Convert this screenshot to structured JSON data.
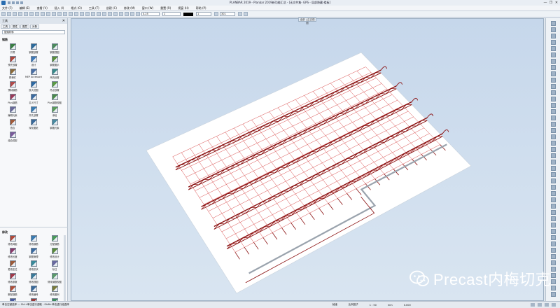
{
  "titlebar": {
    "title": "PLANBAR 2019 - Planbar 2019新功能汇总 - [无文件集- GPS - 局部隐藏-楼板]",
    "controls": [
      "—",
      "❐",
      "✕"
    ]
  },
  "menu": [
    "文件 (F)",
    "编辑 (E)",
    "查看 (V)",
    "插入 (I)",
    "格式 (O)",
    "工具 (T)",
    "创建 (C)",
    "修改 (M)",
    "窗口 (W)",
    "重置 (R)",
    "视窗 (H)",
    "帮助 (P)"
  ],
  "toolbar": {
    "pen_size": "0.25",
    "line_type": "1",
    "color_index": "1",
    "layer_value": "301"
  },
  "palette": {
    "title": "工具",
    "close": "✕",
    "tabs": [
      "工具",
      "属性",
      "图层",
      "对象"
    ],
    "search_placeholder": "搜索构件",
    "section1": "钢筋",
    "section1_tools": [
      {
        "label": "开洞",
        "icon": "opening-icon",
        "color": "#3a7d44"
      },
      {
        "label": "钢筋放置",
        "icon": "rebar-place-icon",
        "color": "#2c6a9b"
      },
      {
        "label": "钢筋视图",
        "icon": "rebar-view-icon",
        "color": "#4b8a5c"
      },
      {
        "label": "预先放置",
        "icon": "pre-place-icon",
        "color": "#b0473c"
      },
      {
        "label": "设计",
        "icon": "design-icon",
        "color": "#3f7ab8"
      },
      {
        "label": "钢筋图示",
        "icon": "rebar-diagram-icon",
        "color": "#5a8f3a"
      },
      {
        "label": "预埋件",
        "icon": "embed-icon",
        "color": "#8a6a3a"
      },
      {
        "label": "MEP Accessories",
        "icon": "mep-icon",
        "color": "#4a6fa5"
      },
      {
        "label": "吊钩设置",
        "icon": "hook-icon",
        "color": "#3a8a8a"
      },
      {
        "label": "预制钢筋",
        "icon": "precast-rebar-icon",
        "color": "#b04a4a"
      },
      {
        "label": "放大范围",
        "icon": "zoom-range-icon",
        "color": "#2f6aa3"
      },
      {
        "label": "吊点放置",
        "icon": "lift-point-icon",
        "color": "#5b9a45"
      },
      {
        "label": "Plus钢筋",
        "icon": "plus-rebar-icon",
        "color": "#9a3a5a"
      },
      {
        "label": "名义尺寸",
        "icon": "nominal-size-icon",
        "color": "#3a6aa0"
      },
      {
        "label": "Plus钢筋视图",
        "icon": "plus-rebar-view-icon",
        "color": "#4a8a4a"
      },
      {
        "label": "编辑元素",
        "icon": "edit-element-icon",
        "color": "#6a6a9a"
      },
      {
        "label": "开孔放置",
        "icon": "hole-place-icon",
        "color": "#3a7ab0"
      },
      {
        "label": "添加",
        "icon": "add-icon",
        "color": "#5a9a5a"
      },
      {
        "label": "叠合",
        "icon": "laminate-icon",
        "color": "#a05a3a"
      },
      {
        "label": "深化图纸",
        "icon": "detail-drawing-icon",
        "color": "#3a6a9a"
      },
      {
        "label": "钢格元素",
        "icon": "grid-element-icon",
        "color": "#4a8aa0"
      },
      {
        "label": "组合成型",
        "icon": "assemble-icon",
        "color": "#7a5a9a"
      }
    ],
    "section2": "修改",
    "section2_tools": [
      {
        "label": "修改间距",
        "icon": "modify-spacing-icon",
        "color": "#b04a3a"
      },
      {
        "label": "修改钢筋",
        "icon": "modify-rebar-icon",
        "color": "#3a7ab0"
      },
      {
        "label": "分配钢筋",
        "icon": "assign-rebar-icon",
        "color": "#4a9a5a"
      },
      {
        "label": "修改长度",
        "icon": "modify-length-icon",
        "color": "#8a3a6a"
      },
      {
        "label": "钢筋管理",
        "icon": "rebar-manage-icon",
        "color": "#3a6aa0"
      },
      {
        "label": "修改设计",
        "icon": "modify-design-icon",
        "color": "#5a8a3a"
      },
      {
        "label": "更改定位",
        "icon": "change-position-icon",
        "color": "#9a5a3a"
      },
      {
        "label": "修改形状",
        "icon": "modify-shape-icon",
        "color": "#3a8a9a"
      },
      {
        "label": "标注",
        "icon": "annotate-icon",
        "color": "#6a6aa0"
      },
      {
        "label": "修改参数",
        "icon": "modify-param-icon",
        "color": "#a03a4a"
      },
      {
        "label": "修改视图",
        "icon": "modify-view-icon",
        "color": "#3a7a9a"
      },
      {
        "label": "修改钢筋视图",
        "icon": "modify-rebar-view-icon",
        "color": "#5a9a6a"
      },
      {
        "label": "删除钢筋",
        "icon": "delete-rebar-icon",
        "color": "#b0503a"
      },
      {
        "label": "修改编号",
        "icon": "modify-number-icon",
        "color": "#3a6a9a"
      },
      {
        "label": "修改图例",
        "icon": "modify-legend-icon",
        "color": "#7a7a3a"
      },
      {
        "label": "钢筋编号",
        "icon": "rebar-number-icon",
        "color": "#4a5aa0"
      },
      {
        "label": "修改钢筋形状",
        "icon": "modify-rebar-shape-icon",
        "color": "#9a3a3a"
      },
      {
        "label": "钢筋表",
        "icon": "rebar-table-icon",
        "color": "#3a8a5a"
      }
    ]
  },
  "viewport": {
    "tab_label": "全部 | 正交视图",
    "grid_color": "#d84a4a",
    "truss_color": "#8a1010",
    "slab_color": "#ffffff",
    "background_top": "#c6d7eb",
    "background_bottom": "#d9e5f1"
  },
  "statusbar": {
    "left": "单击左键选择 — Ctrl+单击进行选取 - Shift+单击进行组选择",
    "ready": "就绪",
    "scale": "1 : 50",
    "unit": "mm",
    "angle": "0.000",
    "coords": "比例因子"
  },
  "watermark": {
    "text": "Precast内梅切克",
    "icon": "wechat-icon"
  }
}
